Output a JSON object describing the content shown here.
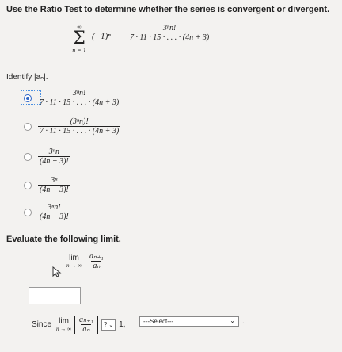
{
  "prompt": "Use the Ratio Test to determine whether the series is convergent or divergent.",
  "series": {
    "upper": "∞",
    "lower": "n = 1",
    "sign": "(−1)ⁿ",
    "numerator": "3ⁿn!",
    "denominator": "7 · 11 · 15 · . . . · (4n + 3)"
  },
  "identify_label": "Identify |aₙ|.",
  "options": [
    {
      "num": "3ⁿn!",
      "den": "7 · 11 · 15 · . . . · (4n + 3)",
      "selected": true
    },
    {
      "num": "(3ⁿn)!",
      "den": "7 · 11 · 15 · . . . · (4n + 3)",
      "selected": false
    },
    {
      "num": "3ⁿn",
      "den": "(4n + 3)!",
      "selected": false
    },
    {
      "num": "3ⁿ",
      "den": "(4n + 3)!",
      "selected": false
    },
    {
      "num": "3ⁿn!",
      "den": "(4n + 3)!",
      "selected": false
    }
  ],
  "evaluate_label": "Evaluate the following limit.",
  "limit": {
    "lim": "lim",
    "sub": "n → ∞",
    "num": "aₙ₊₁",
    "den": "aₙ"
  },
  "answer_value": "",
  "since": {
    "label": "Since",
    "compare_value": "?",
    "one": "1,",
    "select_value": "---Select---",
    "period": "."
  }
}
